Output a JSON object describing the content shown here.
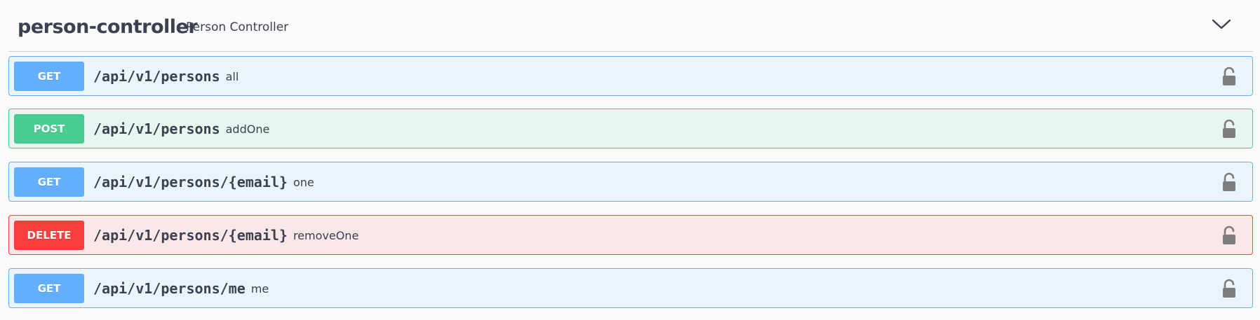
{
  "tag": {
    "name": "person-controller",
    "description": "Person Controller",
    "expand_icon": "chevron-down-icon"
  },
  "operations": [
    {
      "method": "GET",
      "path": "/api/v1/persons",
      "summary": "all",
      "lock_icon": "unlocked-padlock-icon"
    },
    {
      "method": "POST",
      "path": "/api/v1/persons",
      "summary": "addOne",
      "lock_icon": "unlocked-padlock-icon"
    },
    {
      "method": "GET",
      "path": "/api/v1/persons/{email}",
      "summary": "one",
      "lock_icon": "unlocked-padlock-icon"
    },
    {
      "method": "DELETE",
      "path": "/api/v1/persons/{email}",
      "summary": "removeOne",
      "lock_icon": "unlocked-padlock-icon"
    },
    {
      "method": "GET",
      "path": "/api/v1/persons/me",
      "summary": "me",
      "lock_icon": "unlocked-padlock-icon"
    }
  ],
  "colors": {
    "get": "#61affe",
    "post": "#49cc90",
    "delete": "#f93e3e",
    "text": "#3b4151",
    "lock": "#7d7d7d"
  }
}
